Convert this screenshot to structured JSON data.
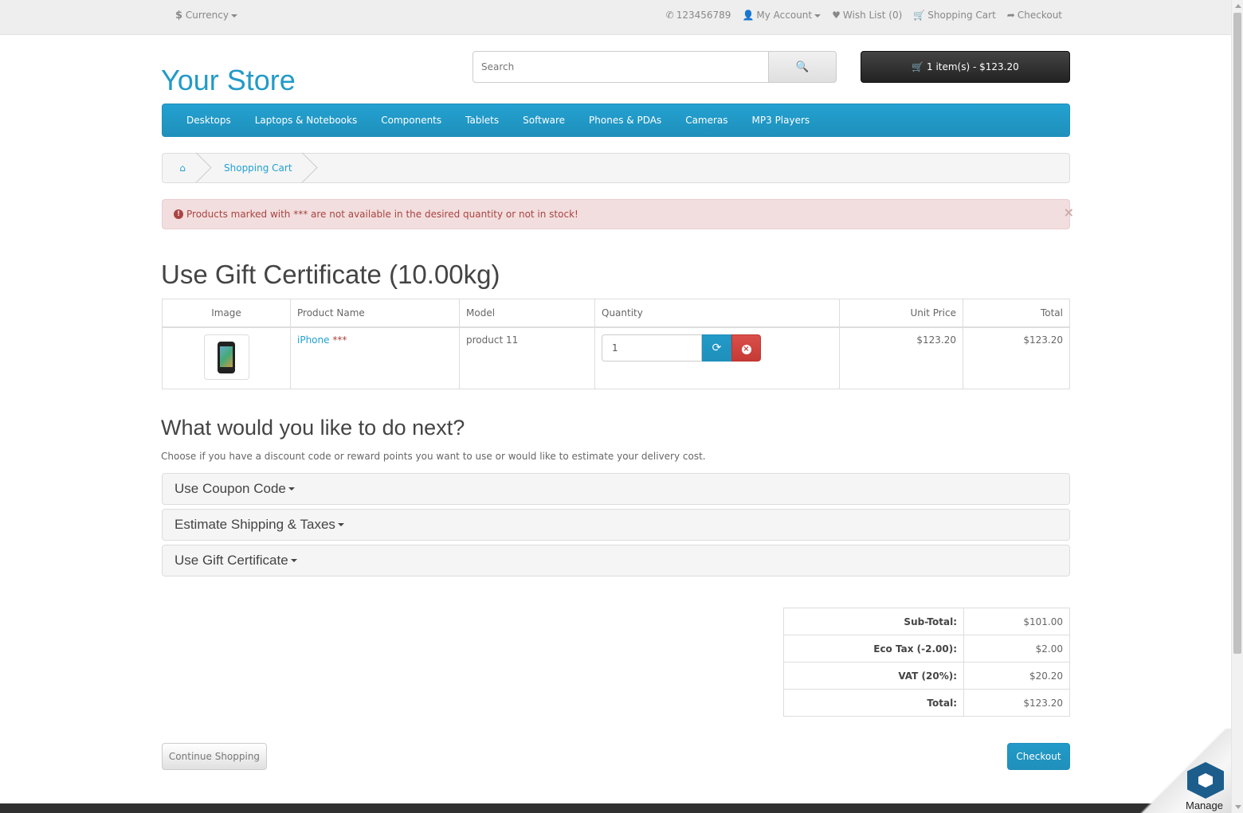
{
  "topbar": {
    "currency_symbol": "$",
    "currency_label": "Currency",
    "phone": "123456789",
    "my_account": "My Account",
    "wishlist": "Wish List (0)",
    "shopping_cart": "Shopping Cart",
    "checkout": "Checkout"
  },
  "header": {
    "logo": "Your Store",
    "search_placeholder": "Search",
    "cart_button": "1 item(s) - $123.20"
  },
  "menu": [
    "Desktops",
    "Laptops & Notebooks",
    "Components",
    "Tablets",
    "Software",
    "Phones & PDAs",
    "Cameras",
    "MP3 Players"
  ],
  "breadcrumb": {
    "current": "Shopping Cart"
  },
  "alert": {
    "text": "Products marked with *** are not available in the desired quantity or not in stock!",
    "close": "×"
  },
  "page_title": "Use Gift Certificate  (10.00kg)",
  "cart_table": {
    "headers": {
      "image": "Image",
      "product": "Product Name",
      "model": "Model",
      "quantity": "Quantity",
      "unit_price": "Unit Price",
      "total": "Total"
    },
    "rows": [
      {
        "product": "iPhone",
        "stock_flag": "***",
        "model": "product 11",
        "quantity": "1",
        "unit_price": "$123.20",
        "total": "$123.20"
      }
    ]
  },
  "next": {
    "heading": "What would you like to do next?",
    "lead": "Choose if you have a discount code or reward points you want to use or would like to estimate your delivery cost.",
    "panels": [
      "Use Coupon Code",
      "Estimate Shipping & Taxes",
      "Use Gift Certificate"
    ]
  },
  "totals": [
    {
      "label": "Sub-Total:",
      "value": "$101.00"
    },
    {
      "label": "Eco Tax (-2.00):",
      "value": "$2.00"
    },
    {
      "label": "VAT (20%):",
      "value": "$20.20"
    },
    {
      "label": "Total:",
      "value": "$123.20"
    }
  ],
  "buttons": {
    "continue": "Continue Shopping",
    "checkout": "Checkout"
  },
  "widget": {
    "label": "Manage"
  }
}
